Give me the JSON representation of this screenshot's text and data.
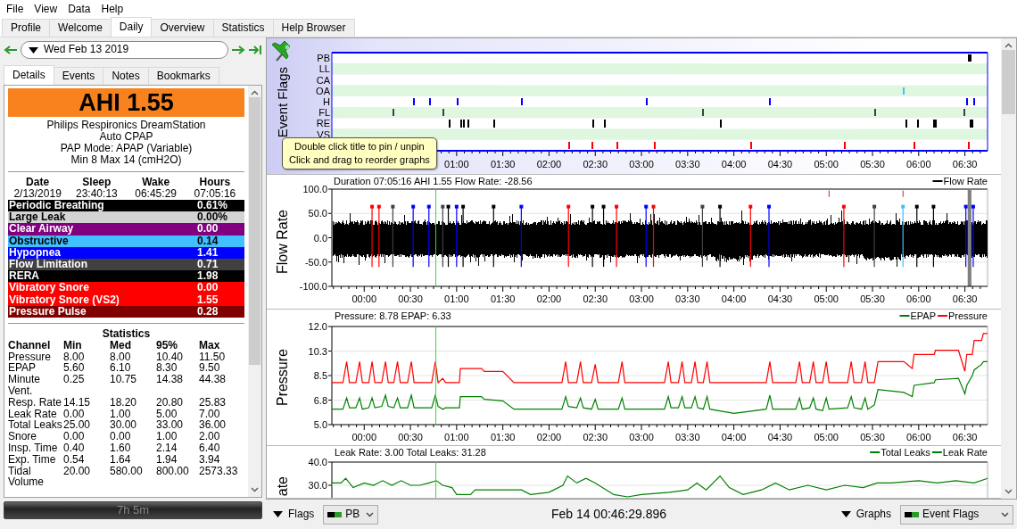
{
  "menu": [
    "File",
    "View",
    "Data",
    "Help"
  ],
  "tabs": [
    {
      "label": "Profile",
      "selected": false
    },
    {
      "label": "Welcome",
      "selected": false
    },
    {
      "label": "Daily",
      "selected": true
    },
    {
      "label": "Overview",
      "selected": false
    },
    {
      "label": "Statistics",
      "selected": false
    },
    {
      "label": "Help Browser",
      "selected": false
    }
  ],
  "date_nav": {
    "date": "Wed Feb 13 2019"
  },
  "detail_tabs": [
    {
      "label": "Details",
      "selected": true
    },
    {
      "label": "Events",
      "selected": false
    },
    {
      "label": "Notes",
      "selected": false
    },
    {
      "label": "Bookmarks",
      "selected": false
    }
  ],
  "details": {
    "ahi": "AHI 1.55",
    "device_lines": [
      "Philips Respironics DreamStation",
      "Auto CPAP",
      "PAP Mode: APAP (Variable)",
      "Min 8 Max 14 (cmH2O)"
    ],
    "session": {
      "columns": [
        "Date",
        "Sleep",
        "Wake",
        "Hours"
      ],
      "values": [
        "2/13/2019",
        "23:40:13",
        "06:45:29",
        "07:05:16"
      ]
    },
    "indices": [
      {
        "name": "Periodic Breathing",
        "value": "0.61%",
        "color": "#000000"
      },
      {
        "name": "Large Leak",
        "value": "0.00%",
        "color": "#d3d3d3"
      },
      {
        "name": "Clear Airway",
        "value": "0.00",
        "color": "#800080"
      },
      {
        "name": "Obstructive",
        "value": "0.14",
        "color": "#40c0ff"
      },
      {
        "name": "Hypopnea",
        "value": "1.41",
        "color": "#0000ff"
      },
      {
        "name": "Flow Limitation",
        "value": "0.71",
        "color": "#404040"
      },
      {
        "name": "RERA",
        "value": "1.98",
        "color": "#000000"
      },
      {
        "name": "Vibratory Snore",
        "value": "0.00",
        "color": "#ff0000"
      },
      {
        "name": "Vibratory Snore (VS2)",
        "value": "1.55",
        "color": "#ff0000"
      },
      {
        "name": "Pressure Pulse",
        "value": "0.28",
        "color": "#800000"
      }
    ],
    "statistics": {
      "title": "Statistics",
      "columns": [
        "Channel",
        "Min",
        "Med",
        "95%",
        "Max"
      ],
      "rows": [
        [
          "Pressure",
          "8.00",
          "8.00",
          "10.40",
          "11.50"
        ],
        [
          "EPAP",
          "5.60",
          "6.10",
          "8.30",
          "9.50"
        ],
        [
          "Minute Vent.",
          "0.25",
          "10.75",
          "14.38",
          "44.38"
        ],
        [
          "Resp. Rate",
          "14.15",
          "18.20",
          "20.80",
          "25.83"
        ],
        [
          "Leak Rate",
          "0.00",
          "1.00",
          "5.00",
          "7.00"
        ],
        [
          "Total Leaks",
          "25.00",
          "30.00",
          "33.00",
          "36.00"
        ],
        [
          "Snore",
          "0.00",
          "0.00",
          "1.00",
          "2.00"
        ],
        [
          "Insp. Time",
          "0.40",
          "1.60",
          "2.14",
          "6.40"
        ],
        [
          "Exp. Time",
          "0.54",
          "1.64",
          "1.94",
          "3.94"
        ],
        [
          "Tidal Volume",
          "20.00",
          "580.00",
          "800.00",
          "2573.33"
        ]
      ]
    },
    "duration": "7h 5m"
  },
  "graphs": [
    {
      "kind": "flags",
      "title": "Event Flags",
      "rows": [
        {
          "label": "PB",
          "color": "#000000"
        },
        {
          "label": "LL"
        },
        {
          "label": "CA"
        },
        {
          "label": "OA",
          "color": "#40c0ff"
        },
        {
          "label": "H",
          "color": "#0000ff"
        },
        {
          "label": "FL",
          "color": "#404040"
        },
        {
          "label": "RE",
          "color": "#000000"
        },
        {
          "label": "VS"
        },
        {
          "color": "#ff0000"
        }
      ],
      "xticks": [
        "01:00",
        "01:30",
        "02:00",
        "02:30",
        "03:00",
        "03:30",
        "04:00",
        "04:30",
        "05:00",
        "05:30",
        "06:00",
        "06:30"
      ]
    },
    {
      "kind": "waveform",
      "title": "Flow Rate",
      "info": "Duration 07:05:16 AHI 1.55 Flow Rate: -28.56",
      "legend": [
        {
          "name": "Flow Rate",
          "color": "#000000"
        }
      ],
      "yticks": [
        "100.0",
        "50.0",
        "0.0",
        "-50.0",
        "-100.0"
      ],
      "xticks": [
        "00:00",
        "00:30",
        "01:00",
        "01:30",
        "02:00",
        "02:30",
        "03:00",
        "03:30",
        "04:00",
        "04:30",
        "05:00",
        "05:30",
        "06:00",
        "06:30"
      ]
    },
    {
      "kind": "line",
      "title": "Pressure",
      "info": "Pressure: 8.78 EPAP: 6.33",
      "chart_data": {
        "type": "line",
        "xlim": [
          -0.35,
          6.745
        ],
        "ylim": [
          5,
          12
        ],
        "grid": true,
        "legend": "upper right",
        "yticks": [
          {
            "value": 5,
            "label": "5.0"
          },
          {
            "value": 6.75,
            "label": "6.8"
          },
          {
            "value": 8.5,
            "label": "8.5"
          },
          {
            "value": 10.25,
            "label": "10.3"
          },
          {
            "value": 12,
            "label": "12.0"
          }
        ],
        "xticks": [
          {
            "value": 0,
            "label": "00:00"
          },
          {
            "value": 0.5,
            "label": "00:30"
          },
          {
            "value": 1,
            "label": "01:00"
          },
          {
            "value": 1.5,
            "label": "01:30"
          },
          {
            "value": 2,
            "label": "02:00"
          },
          {
            "value": 2.5,
            "label": "02:30"
          },
          {
            "value": 3,
            "label": "03:00"
          },
          {
            "value": 3.5,
            "label": "03:30"
          },
          {
            "value": 4,
            "label": "04:00"
          },
          {
            "value": 4.5,
            "label": "04:30"
          },
          {
            "value": 5,
            "label": "05:00"
          },
          {
            "value": 5.5,
            "label": "05:30"
          },
          {
            "value": 6,
            "label": "06:00"
          },
          {
            "value": 6.5,
            "label": "06:30"
          }
        ],
        "ref_lines": [
          {
            "axis": "x",
            "value": 0.775,
            "color": "#33dd33"
          }
        ],
        "x": [
          -0.35,
          -0.23,
          -0.19,
          -0.16,
          -0.09,
          -0.05,
          -0.02,
          0.05,
          0.085,
          0.115,
          0.19,
          0.23,
          0.26,
          0.32,
          0.36,
          0.39,
          0.47,
          0.51,
          0.54,
          0.73,
          0.77,
          0.8,
          0.85,
          0.88,
          1.03,
          1.04,
          1.27,
          1.3,
          1.5,
          1.62,
          2.14,
          2.18,
          2.21,
          2.3,
          2.34,
          2.37,
          2.46,
          2.5,
          2.53,
          2.75,
          2.79,
          2.82,
          3.25,
          3.29,
          3.32,
          3.4,
          3.44,
          3.47,
          3.54,
          3.58,
          3.61,
          3.67,
          3.71,
          3.74,
          4.0,
          4.35,
          4.39,
          4.42,
          4.67,
          4.71,
          4.74,
          4.82,
          4.86,
          4.89,
          4.96,
          5.0,
          5.03,
          5.23,
          5.27,
          5.3,
          5.38,
          5.42,
          5.45,
          5.52,
          5.56,
          5.84,
          5.93,
          5.95,
          6.17,
          6.18,
          6.43,
          6.5,
          6.52,
          6.58,
          6.6,
          6.68,
          6.7,
          6.745
        ],
        "series": [
          {
            "name": "EPAP",
            "color": "#008000",
            "values": [
              6.1,
              6.1,
              6.9,
              6.2,
              6.2,
              6.9,
              6.1,
              6.2,
              6.9,
              6.2,
              6.3,
              7.1,
              6.3,
              6.2,
              6.9,
              6.2,
              6.2,
              7.1,
              6.2,
              6.2,
              7.1,
              6.3,
              6.1,
              6.2,
              6.2,
              7.0,
              7.0,
              6.8,
              6.7,
              6.1,
              6.1,
              7.0,
              6.3,
              6.2,
              6.9,
              6.2,
              6.1,
              6.8,
              6.1,
              6.1,
              6.9,
              6.1,
              6.1,
              7.0,
              6.2,
              6.2,
              7.0,
              6.2,
              6.2,
              7.0,
              6.2,
              6.1,
              7.0,
              6.1,
              5.8,
              6.1,
              7.1,
              6.1,
              6.1,
              6.9,
              6.1,
              6.2,
              6.9,
              6.1,
              6.0,
              6.9,
              6.1,
              6.2,
              7.0,
              6.2,
              6.1,
              6.9,
              6.1,
              6.4,
              7.5,
              7.3,
              7.0,
              7.8,
              8.0,
              8.2,
              8.3,
              7.2,
              7.8,
              8.5,
              8.9,
              9.3,
              9.5,
              9.5
            ]
          },
          {
            "name": "Pressure",
            "color": "#ff0000",
            "values": [
              8,
              8,
              9.5,
              8,
              8,
              9.5,
              8,
              8,
              9.5,
              8,
              8,
              9.5,
              8,
              8,
              9.5,
              8,
              8,
              9.5,
              8,
              8,
              9.5,
              8,
              8.3,
              8,
              8,
              9,
              9,
              8.8,
              8.8,
              8,
              8,
              9.5,
              8,
              8,
              9.5,
              8,
              8,
              9.3,
              8,
              8,
              9.5,
              8,
              8,
              9.5,
              8,
              8,
              9.5,
              8,
              8,
              9.5,
              8,
              8,
              9.5,
              8,
              8,
              8,
              9.5,
              8,
              8,
              9.5,
              8,
              8,
              9.5,
              8,
              8,
              9.5,
              8,
              8,
              9.5,
              8,
              8,
              9.5,
              8,
              8,
              9.5,
              9.5,
              9.0,
              10,
              10,
              10.3,
              10.3,
              8.8,
              10,
              10,
              11,
              11,
              11.5,
              11.5
            ]
          }
        ]
      }
    },
    {
      "kind": "line",
      "title": "ate",
      "info": "Leak Rate: 3.00 Total Leaks: 31.28",
      "extra_legend": [
        {
          "name": "Leak Rate",
          "color": "#008000"
        }
      ],
      "chart_data": {
        "type": "line",
        "xlim": [
          -0.35,
          6.745
        ],
        "ylim": [
          0,
          40
        ],
        "grid": true,
        "legend": "upper right",
        "yticks": [
          {
            "value": 30,
            "label": "30.0"
          },
          {
            "value": 40,
            "label": "40.0"
          }
        ],
        "ref_lines": [
          {
            "axis": "x",
            "value": 0.775,
            "color": "#33dd33"
          }
        ],
        "x": [
          -0.35,
          -0.25,
          -0.2,
          -0.12,
          0,
          0.1,
          0.2,
          0.3,
          0.4,
          0.5,
          0.6,
          0.7,
          0.78,
          0.85,
          0.95,
          1,
          1.15,
          1.2,
          1.5,
          1.7,
          1.8,
          2,
          2.15,
          2.2,
          2.3,
          2.4,
          2.5,
          2.7,
          2.85,
          3,
          3.3,
          3.5,
          3.6,
          3.7,
          3.85,
          3.95,
          4.1,
          4.3,
          4.45,
          4.6,
          4.8,
          5,
          5.2,
          5.4,
          5.55,
          5.7,
          6,
          6.2,
          6.4,
          6.6,
          6.745
        ],
        "series": [
          {
            "name": "Total Leaks",
            "color": "#008000",
            "values": [
              31,
              31,
              33,
              29,
              31,
              30,
              32,
              30,
              32,
              30,
              30,
              31,
              32,
              30,
              29,
              26,
              26,
              28,
              28,
              28,
              26,
              27,
              30,
              34,
              31,
              33,
              31,
              26,
              25,
              26,
              27,
              28,
              31,
              28,
              34,
              29,
              26,
              28,
              31,
              28,
              30,
              28,
              30,
              29,
              31,
              31,
              32,
              31,
              32,
              31,
              33
            ]
          }
        ]
      }
    }
  ],
  "tooltip": {
    "lines": [
      "Double click title to pin / unpin",
      "Click and drag to reorder graphs"
    ]
  },
  "bottom_bar": {
    "flags_label": "Flags",
    "flag_choice": "PB",
    "time": "Feb 14 00:46:29.896",
    "graphs_label": "Graphs",
    "graph_choice": "Event Flags"
  }
}
